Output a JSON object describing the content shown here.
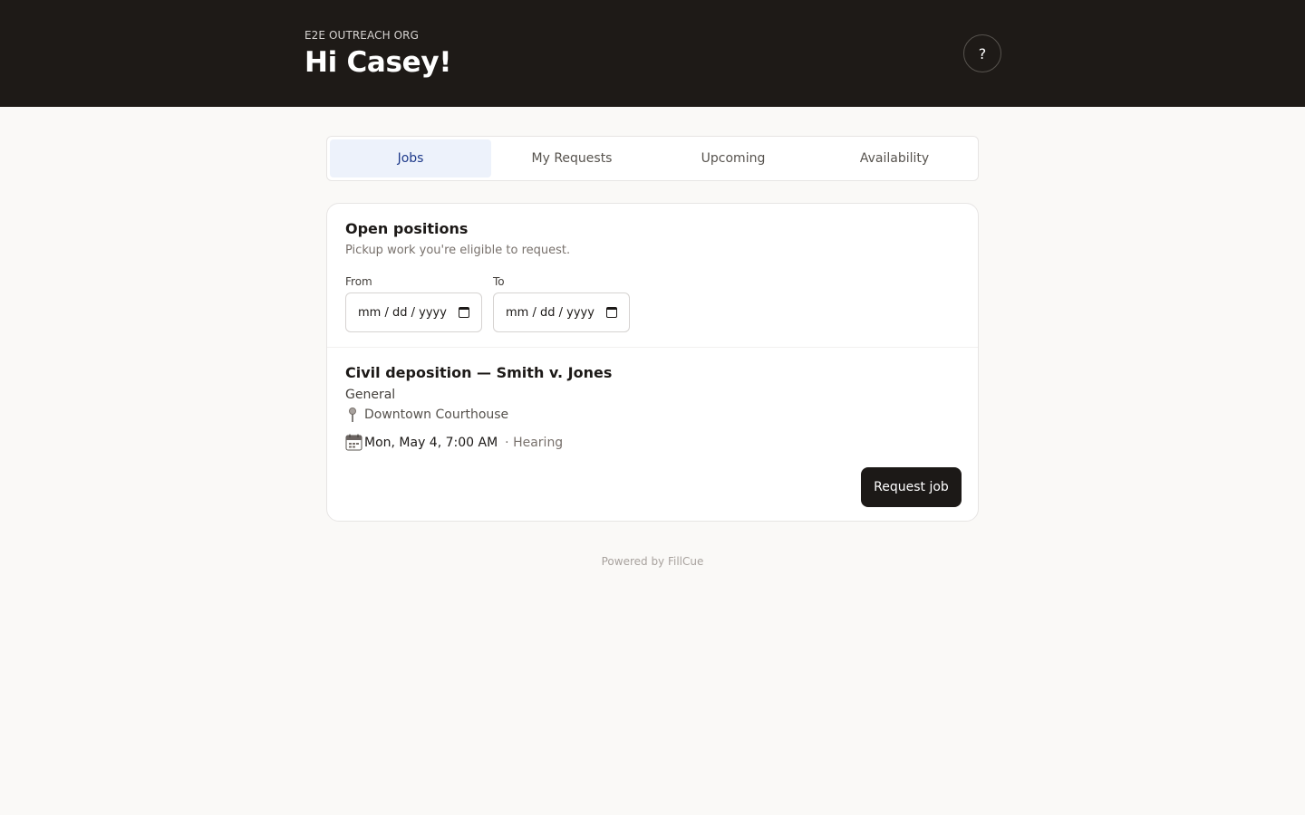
{
  "header": {
    "org_name": "E2E OUTREACH ORG",
    "greeting": "Hi Casey!",
    "help_label": "?"
  },
  "tabs": [
    {
      "label": "Jobs",
      "active": true
    },
    {
      "label": "My Requests",
      "active": false
    },
    {
      "label": "Upcoming",
      "active": false
    },
    {
      "label": "Availability",
      "active": false
    }
  ],
  "open_positions": {
    "title": "Open positions",
    "subtitle": "Pickup work you're eligible to request.",
    "from_label": "From",
    "from_value": "mm / dd / yyyy",
    "to_label": "To",
    "to_value": "mm / dd / yyyy"
  },
  "job": {
    "title": "Civil deposition — Smith v. Jones",
    "category": "General",
    "location": "Downtown Courthouse",
    "datetime": "Mon, May 4, 7:00 AM",
    "type": "· Hearing",
    "request_label": "Request job"
  },
  "footer": {
    "text": "Powered by FillCue"
  },
  "colors": {
    "header_bg": "#1e1a17",
    "active_tab_bg": "#edf2fb",
    "active_tab_text": "#1e3a8a",
    "button_bg": "#1c1917"
  },
  "icons": {
    "help": "question-mark",
    "location": "pin-icon",
    "date": "calendar-icon",
    "date_input": "calendar-picker-icon"
  }
}
